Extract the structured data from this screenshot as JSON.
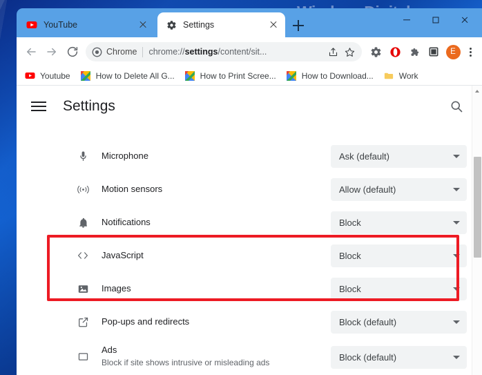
{
  "watermark": {
    "text": "WindowsDigital.com"
  },
  "window": {
    "controls": [
      {
        "name": "minimize",
        "label": "Minimize"
      },
      {
        "name": "maximize",
        "label": "Maximize"
      },
      {
        "name": "close",
        "label": "Close"
      }
    ]
  },
  "tabs": [
    {
      "title": "YouTube",
      "favicon": "youtube-icon",
      "active": false
    },
    {
      "title": "Settings",
      "favicon": "gear-icon",
      "active": true
    }
  ],
  "newtab": {
    "label": "New Tab",
    "icon": "plus-icon"
  },
  "toolbar": {
    "back": {
      "icon": "arrow-left-icon",
      "label": "Back"
    },
    "forward": {
      "icon": "arrow-right-icon",
      "label": "Forward"
    },
    "reload": {
      "icon": "reload-icon",
      "label": "Reload"
    },
    "omnibox": {
      "chip_icon": "chrome-logo-icon",
      "chip_label": "Chrome",
      "url_prefix": "chrome://",
      "url_bold": "settings",
      "url_suffix": "/content/sit...",
      "full_url": "chrome://settings/content/sit...",
      "share_icon": "share-icon",
      "bookmark_icon": "star-icon"
    },
    "actions": [
      {
        "icon": "gear-icon",
        "label": "Settings extension"
      },
      {
        "icon": "opera-icon",
        "label": "Extension"
      },
      {
        "icon": "puzzle-icon",
        "label": "Extensions"
      },
      {
        "icon": "square-icon",
        "label": "Side panel"
      }
    ],
    "avatar": {
      "initial": "E",
      "label": "Profile",
      "color": "#eb6a1e"
    },
    "menu": {
      "icon": "kebab-icon",
      "label": "Customize and control Google Chrome"
    }
  },
  "bookmarks": [
    {
      "label": "Youtube",
      "icon": "youtube-icon"
    },
    {
      "label": "How to Delete All G...",
      "icon": "colorful-icon"
    },
    {
      "label": "How to Print Scree...",
      "icon": "colorful-icon"
    },
    {
      "label": "How to Download...",
      "icon": "colorful-icon"
    },
    {
      "label": "Work",
      "icon": "folder-icon"
    }
  ],
  "settings": {
    "menu_label": "Main menu",
    "title": "Settings",
    "search_label": "Search settings",
    "search_icon": "search-icon"
  },
  "content_rows": [
    {
      "icon": "microphone-icon",
      "label": "Microphone",
      "sub": "",
      "value": "Ask (default)",
      "highlighted": false
    },
    {
      "icon": "motion-sensors-icon",
      "label": "Motion sensors",
      "sub": "",
      "value": "Allow (default)",
      "highlighted": false
    },
    {
      "icon": "bell-icon",
      "label": "Notifications",
      "sub": "",
      "value": "Block",
      "highlighted": false
    },
    {
      "icon": "code-brackets-icon",
      "label": "JavaScript",
      "sub": "",
      "value": "Block",
      "highlighted": true
    },
    {
      "icon": "image-icon",
      "label": "Images",
      "sub": "",
      "value": "Block",
      "highlighted": true
    },
    {
      "icon": "popup-icon",
      "label": "Pop-ups and redirects",
      "sub": "",
      "value": "Block (default)",
      "highlighted": false
    },
    {
      "icon": "ads-icon",
      "label": "Ads",
      "sub": "Block if site shows intrusive or misleading ads",
      "value": "Block (default)",
      "highlighted": false
    }
  ],
  "annotation": {
    "color": "#ed1b24",
    "targets": [
      "JavaScript",
      "Images"
    ]
  },
  "scrollbar": {
    "position_percent": 29
  }
}
